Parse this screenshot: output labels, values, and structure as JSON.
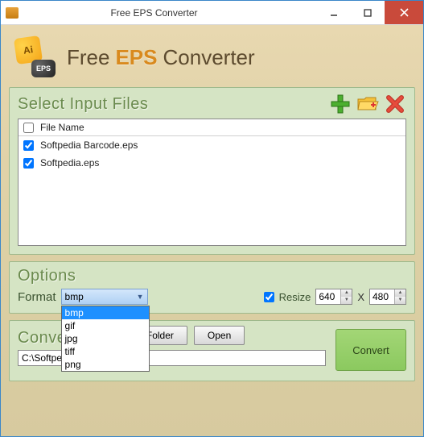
{
  "window": {
    "title": "Free EPS Converter"
  },
  "app": {
    "logo_main": "Ai",
    "logo_sub": "EPS",
    "title_seg1": "Free",
    "title_seg2": "EPS",
    "title_seg3": "Converter"
  },
  "input_section": {
    "title": "Select Input Files",
    "header_checked": false,
    "header_label": "File Name",
    "files": [
      {
        "name": "Softpedia Barcode.eps",
        "checked": true
      },
      {
        "name": "Softpedia.eps",
        "checked": true
      }
    ],
    "icons": {
      "add": "plus-icon",
      "browse": "folder-icon",
      "remove": "x-icon"
    }
  },
  "options": {
    "title": "Options",
    "format_label": "Format",
    "format_selected": "bmp",
    "format_options": [
      "bmp",
      "gif",
      "jpg",
      "tiff",
      "png"
    ],
    "resize_label": "Resize",
    "resize_checked": true,
    "resize_width": "640",
    "resize_x": "X",
    "resize_height": "480"
  },
  "convert": {
    "title": "Convert",
    "output_folder_btn": "Output Folder",
    "open_btn": "Open",
    "convert_btn": "Convert",
    "output_path": "C:\\SoftpediaTest"
  },
  "colors": {
    "accent_orange": "#d98a1e",
    "panel_green": "#d5e4c4",
    "convert_green": "#8bc95f",
    "titlebar_close": "#c94a3b"
  }
}
